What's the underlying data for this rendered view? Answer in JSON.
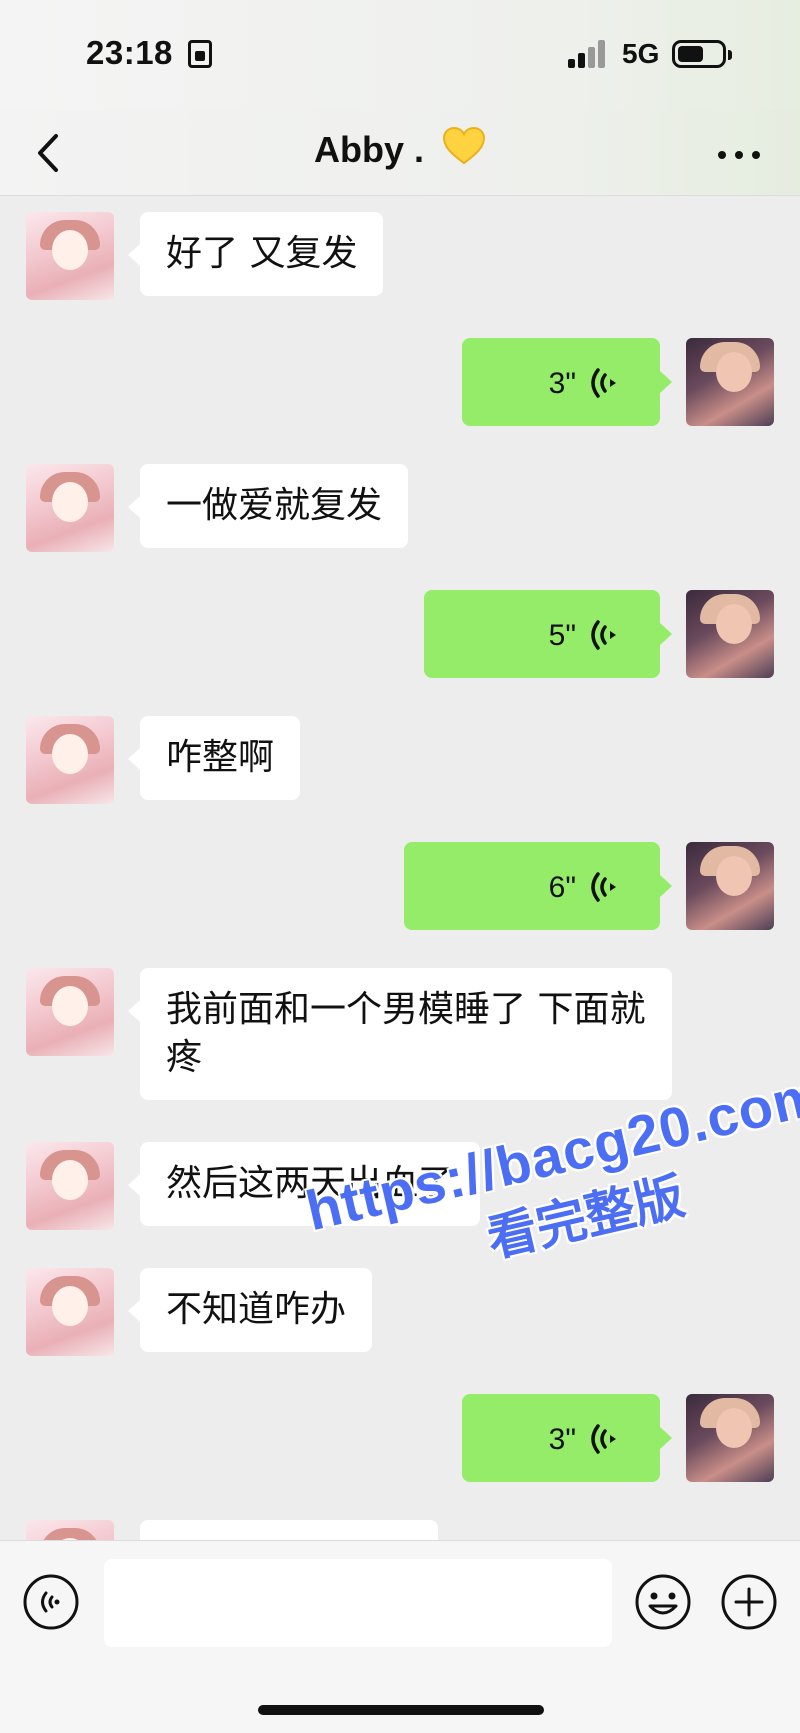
{
  "status_bar": {
    "time": "23:18",
    "network": "5G",
    "battery_level": 0.6
  },
  "header": {
    "title": "Abby .",
    "title_emoji": "yellow-heart-icon"
  },
  "messages": [
    {
      "side": "in",
      "type": "text",
      "text": "好了 又复发"
    },
    {
      "side": "out",
      "type": "voice",
      "duration": "3\""
    },
    {
      "side": "in",
      "type": "text",
      "text": "一做爱就复发"
    },
    {
      "side": "out",
      "type": "voice",
      "duration": "5\""
    },
    {
      "side": "in",
      "type": "text",
      "text": "咋整啊"
    },
    {
      "side": "out",
      "type": "voice",
      "duration": "6\""
    },
    {
      "side": "in",
      "type": "text",
      "text": "我前面和一个男模睡了 下面就疼"
    },
    {
      "side": "in",
      "type": "text",
      "text": "然后这两天出血了"
    },
    {
      "side": "in",
      "type": "text",
      "text": "不知道咋办"
    },
    {
      "side": "out",
      "type": "voice",
      "duration": "3\""
    },
    {
      "side": "in",
      "type": "text",
      "text": ""
    }
  ],
  "watermark": {
    "line1": "https://bacg20.com",
    "line2": "看完整版"
  },
  "input_bar": {
    "text_value": ""
  },
  "colors": {
    "outgoing_bubble": "#95ec69",
    "incoming_bubble": "#ffffff",
    "background": "#ededed",
    "watermark": "#4c6ef5"
  }
}
